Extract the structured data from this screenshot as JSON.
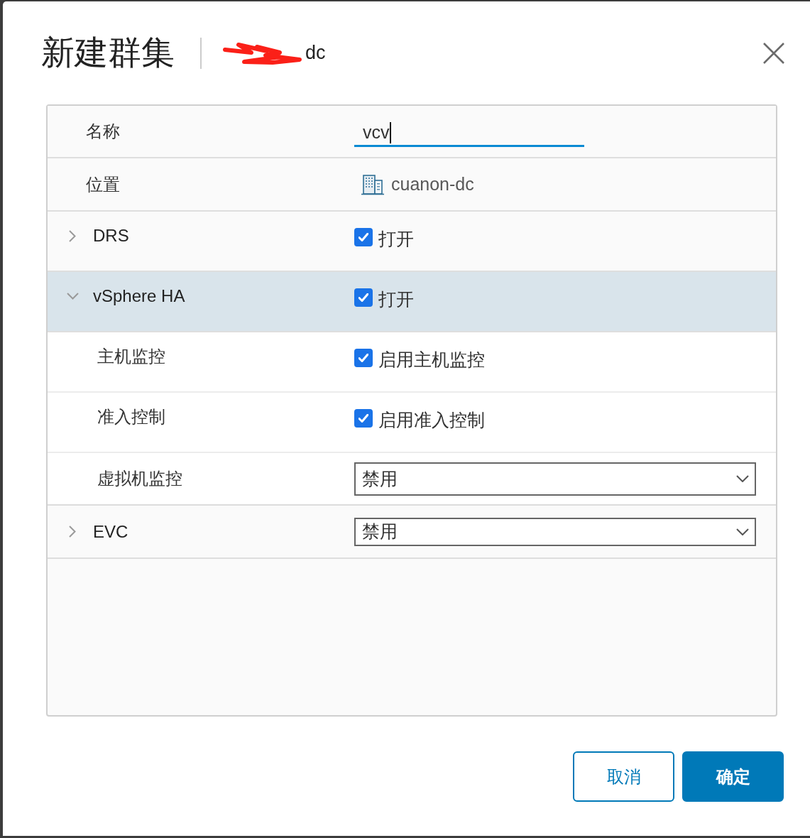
{
  "dialog": {
    "title": "新建群集",
    "subtitle": "dc",
    "subtitle_redacted": true
  },
  "form": {
    "rows": [
      {
        "kind": "text-input",
        "label": "名称",
        "value": "vcv",
        "focused": true
      },
      {
        "kind": "location",
        "label": "位置",
        "value": "cuanon-dc"
      },
      {
        "kind": "checkbox",
        "label": "DRS",
        "expanded": false,
        "checked": true,
        "option": "打开"
      },
      {
        "kind": "checkbox",
        "label": "vSphere HA",
        "expanded": true,
        "checked": true,
        "option": "打开",
        "children": [
          {
            "kind": "checkbox",
            "label": "主机监控",
            "checked": true,
            "option": "启用主机监控"
          },
          {
            "kind": "checkbox",
            "label": "准入控制",
            "checked": true,
            "option": "启用准入控制"
          },
          {
            "kind": "select",
            "label": "虚拟机监控",
            "value": "禁用"
          }
        ]
      },
      {
        "kind": "select",
        "label": "EVC",
        "expanded": false,
        "value": "禁用"
      }
    ]
  },
  "buttons": [
    {
      "label": "取消",
      "kind": "secondary"
    },
    {
      "label": "确定",
      "kind": "primary"
    }
  ]
}
